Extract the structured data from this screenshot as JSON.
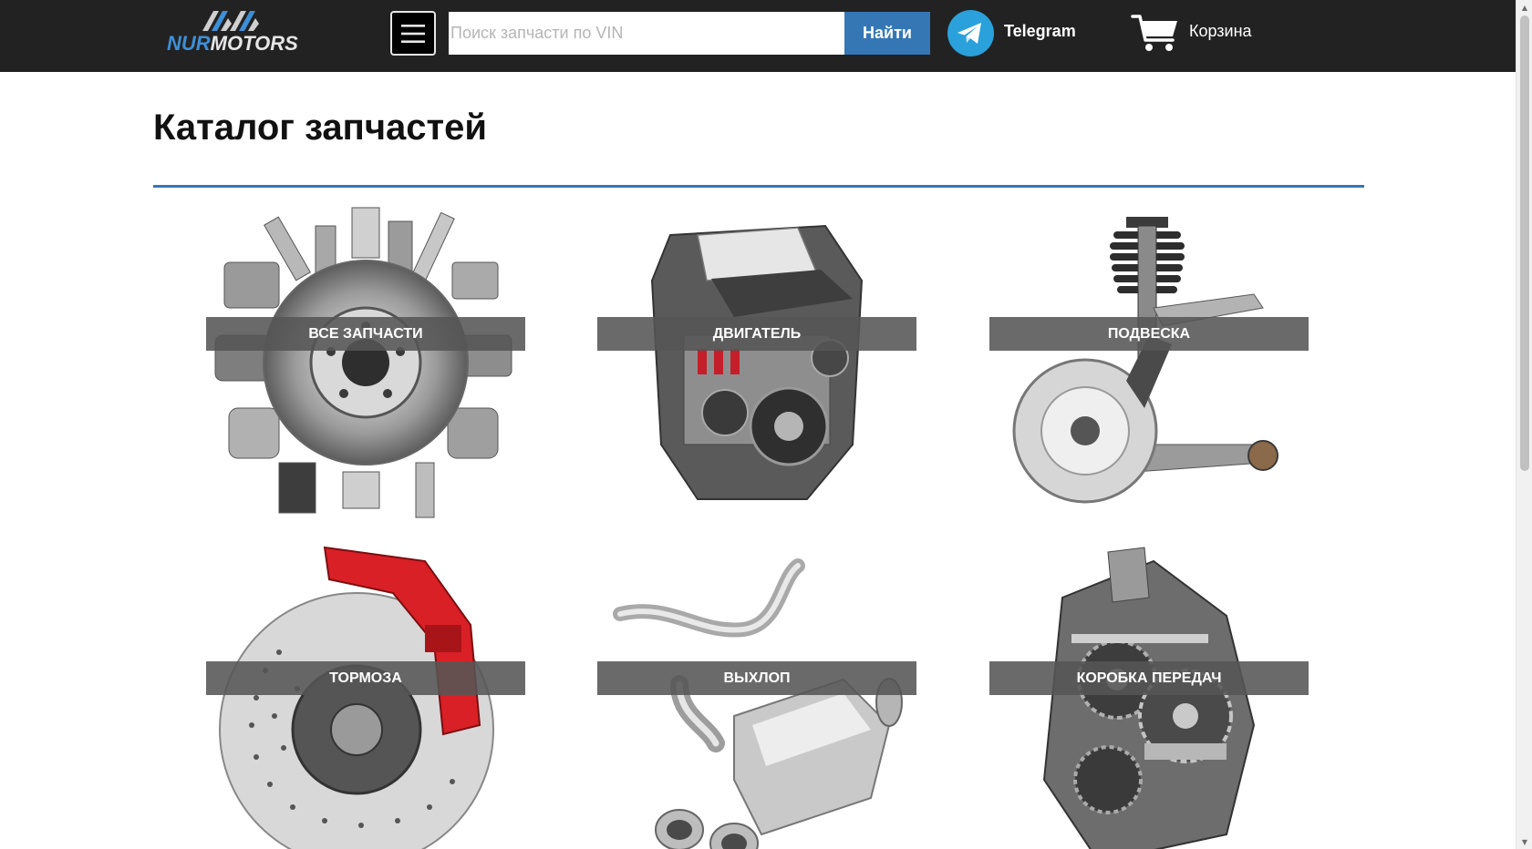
{
  "header": {
    "logo": {
      "word_part1": "NUR",
      "word_part2": "MOTORS"
    },
    "menu_icon": "hamburger-icon",
    "search": {
      "placeholder": "Поиск запчасти по VIN",
      "value": "",
      "button_label": "Найти"
    },
    "telegram": {
      "icon": "telegram-icon",
      "label": "Telegram"
    },
    "cart": {
      "icon": "cart-icon",
      "label": "Корзина"
    }
  },
  "main": {
    "title": "Каталог запчастей",
    "categories": [
      {
        "label": "ВСЕ ЗАПЧАСТИ",
        "image": "assorted-parts-image"
      },
      {
        "label": "ДВИГАТЕЛЬ",
        "image": "engine-image"
      },
      {
        "label": "ПОДВЕСКА",
        "image": "suspension-image"
      },
      {
        "label": "ТОРМОЗА",
        "image": "brakes-image"
      },
      {
        "label": "ВЫХЛОП",
        "image": "exhaust-image"
      },
      {
        "label": "КОРОБКА ПЕРЕДАЧ",
        "image": "gearbox-image"
      }
    ]
  },
  "colors": {
    "header_bg": "#222222",
    "accent": "#3577b5",
    "telegram": "#2aa1da",
    "label_band": "#555555"
  }
}
